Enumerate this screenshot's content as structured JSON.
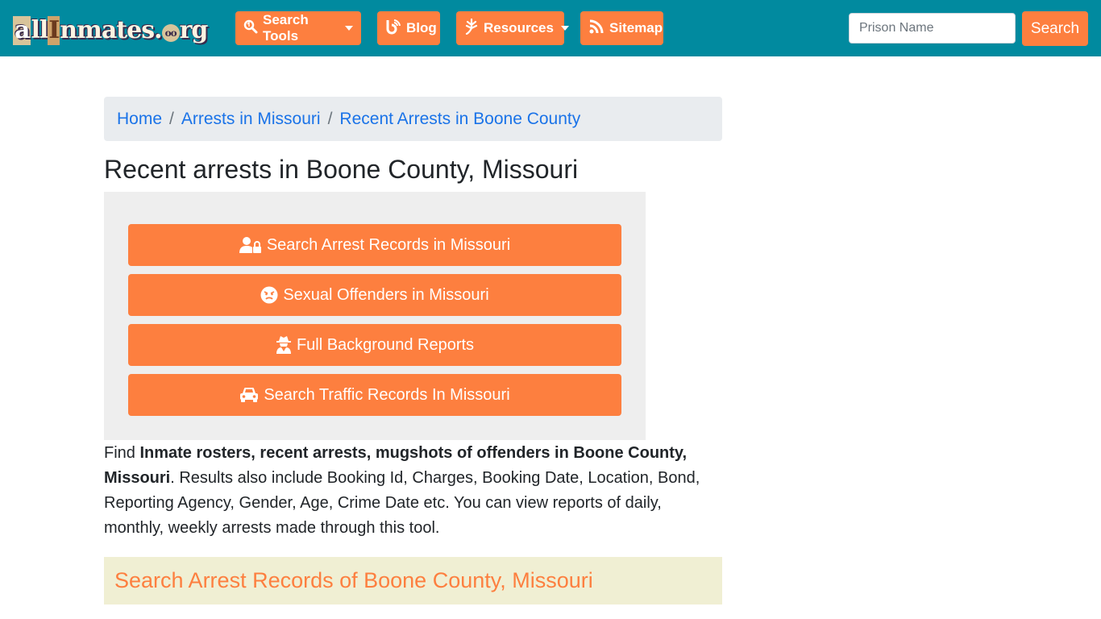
{
  "brand": {
    "logo_text_a": "a",
    "logo_text_ll": "ll",
    "logo_text_i": "I",
    "logo_text_rest": "nmates.",
    "logo_text_o": "oo",
    "logo_text_rg": "rg",
    "accent_color": "#fd7f3f",
    "navbar_color": "#018a9f"
  },
  "nav": {
    "items": [
      {
        "label": "Search Tools",
        "icon": "search-icon",
        "has_dropdown": true
      },
      {
        "label": "Blog",
        "icon": "blog-icon",
        "has_dropdown": false
      },
      {
        "label": "Resources",
        "icon": "leaf-icon",
        "has_dropdown": true
      },
      {
        "label": "Sitemap",
        "icon": "rss-icon",
        "has_dropdown": false
      }
    ],
    "search": {
      "placeholder": "Prison Name",
      "value": "",
      "button_label": "Search"
    }
  },
  "breadcrumb": [
    {
      "label": "Home"
    },
    {
      "label": "Arrests in Missouri"
    },
    {
      "label": "Recent Arrests in Boone County"
    }
  ],
  "page": {
    "title": "Recent arrests in Boone County, Missouri",
    "cta_buttons": [
      {
        "label": "Search Arrest Records in Missouri",
        "icon": "user-lock-icon"
      },
      {
        "label": "Sexual Offenders in Missouri",
        "icon": "angry-face-icon"
      },
      {
        "label": "Full Background Reports",
        "icon": "user-secret-icon"
      },
      {
        "label": "Search Traffic Records In Missouri",
        "icon": "car-icon"
      }
    ],
    "description": {
      "lead": "Find ",
      "bold": "Inmate rosters, recent arrests, mugshots of offenders in Boone County, Missouri",
      "rest": ". Results also include Booking Id, Charges, Booking Date, Location, Bond, Reporting Agency, Gender, Age, Crime Date etc. You can view reports of daily, monthly, weekly arrests made through this tool."
    },
    "section_heading": "Search Arrest Records of Boone County, Missouri"
  }
}
